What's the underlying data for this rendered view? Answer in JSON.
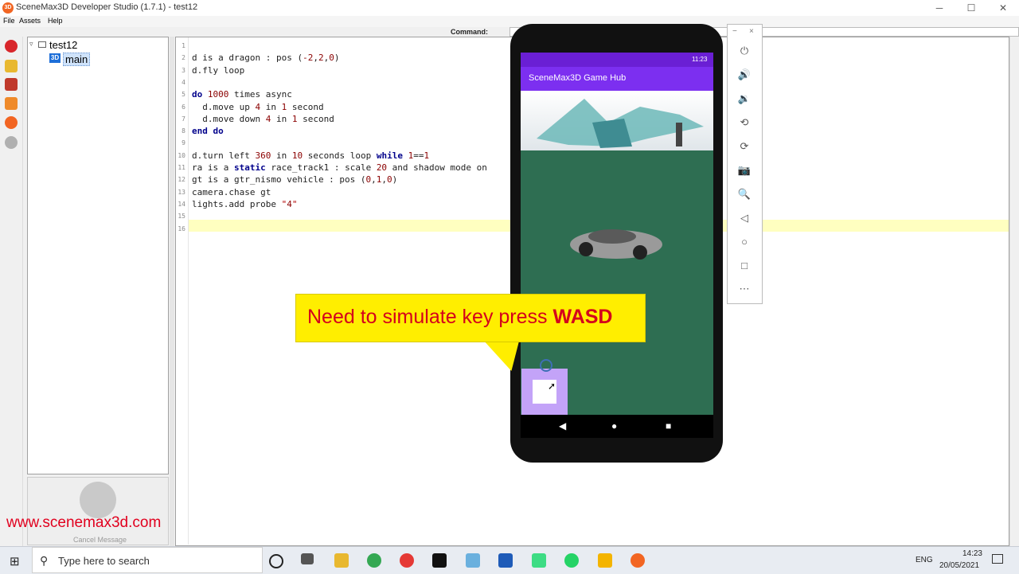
{
  "window": {
    "title": "SceneMax3D Developer Studio (1.7.1) - test12",
    "logo_text": "3D",
    "minimize": "─",
    "maximize": "☐",
    "close": "✕"
  },
  "menu": [
    "File",
    "Assets",
    "Help"
  ],
  "command": {
    "label": "Command:",
    "value": ""
  },
  "tree": {
    "root": {
      "toggle": "▿",
      "label": "test12"
    },
    "child": {
      "icon_text": "3D",
      "label": "main"
    }
  },
  "bottom_panel": {
    "cancel_label": "Cancel Message"
  },
  "website": "www.scenemax3d.com",
  "editor": {
    "lines": [
      {
        "n": "1",
        "text": ""
      },
      {
        "n": "2",
        "text": "d is a dragon : pos (-2,2,0)"
      },
      {
        "n": "3",
        "text": "d.fly loop"
      },
      {
        "n": "4",
        "text": ""
      },
      {
        "n": "5",
        "text": "do 1000 times async"
      },
      {
        "n": "6",
        "text": "  d.move up 4 in 1 second"
      },
      {
        "n": "7",
        "text": "  d.move down 4 in 1 second"
      },
      {
        "n": "8",
        "text": "end do"
      },
      {
        "n": "9",
        "text": ""
      },
      {
        "n": "10",
        "text": "d.turn left 360 in 10 seconds loop while 1==1"
      },
      {
        "n": "11",
        "text": "ra is a static race_track1 : scale 20 and shadow mode on"
      },
      {
        "n": "12",
        "text": "gt is a gtr_nismo vehicle : pos (0,1,0)"
      },
      {
        "n": "13",
        "text": "camera.chase gt"
      },
      {
        "n": "14",
        "text": "lights.add probe \"4\""
      },
      {
        "n": "15",
        "text": ""
      },
      {
        "n": "16",
        "text": ""
      }
    ]
  },
  "phone": {
    "status_time": "11:23",
    "app_title": "SceneMax3D Game Hub",
    "nav": {
      "back": "◀",
      "home": "●",
      "recents": "■"
    }
  },
  "emulator_panel": {
    "minimize": "−",
    "close": "×",
    "buttons": [
      "⏻",
      "🔊",
      "🔉",
      "⟲",
      "⟳",
      "📷",
      "🔍",
      "◁",
      "○",
      "□",
      "⋯"
    ]
  },
  "callout": {
    "text": "Need to simulate key press ",
    "strong": "WASD"
  },
  "taskbar": {
    "start_icon": "⊞",
    "search_icon": "⚲",
    "search_placeholder": "Type here to search",
    "language": "ENG",
    "time": "14:23",
    "date": "20/05/2021"
  },
  "colors": {
    "accent_red": "#e1001e",
    "app_bar": "#7c2ff0",
    "game_ground": "#2e6e52",
    "callout_bg": "#ffee00"
  }
}
